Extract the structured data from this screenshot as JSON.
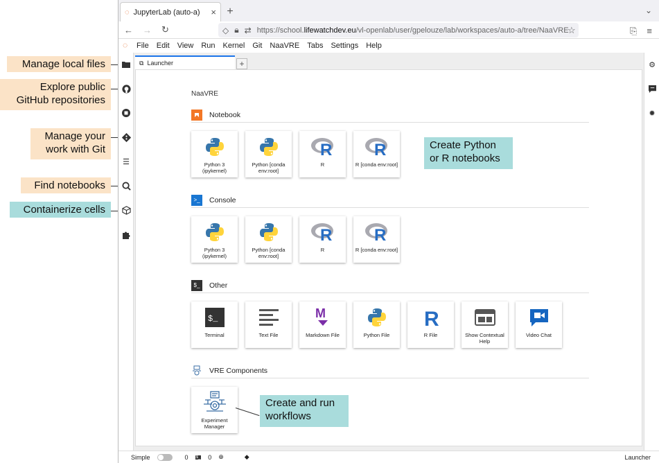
{
  "annotations": {
    "manage_files": "Manage local files",
    "explore_github": "Explore public GitHub repositories",
    "manage_git": "Manage your work with Git",
    "find_notebooks": "Find notebooks",
    "containerize": "Containerize cells",
    "create_notebooks": "Create Python or R notebooks",
    "create_workflows": "Create and run workflows"
  },
  "browser": {
    "tab_title": "JupyterLab (auto-a)",
    "url_prefix": "https://school.",
    "url_host": "lifewatchdev.eu",
    "url_path": "/vl-openlab/user/gpelouze/lab/workspaces/auto-a/tree/NaaVRE"
  },
  "menu": [
    "File",
    "Edit",
    "View",
    "Run",
    "Kernel",
    "Git",
    "NaaVRE",
    "Tabs",
    "Settings",
    "Help"
  ],
  "launcher": {
    "tab_label": "Launcher",
    "heading": "NaaVRE",
    "sections": {
      "notebook": "Notebook",
      "console": "Console",
      "other": "Other",
      "vre": "VRE Components"
    },
    "notebook_items": [
      "Python 3 (ipykernel)",
      "Python [conda env:root]",
      "R",
      "R [conda env:root]"
    ],
    "console_items": [
      "Python 3 (ipykernel)",
      "Python [conda env:root]",
      "R",
      "R [conda env:root]"
    ],
    "other_items": [
      "Terminal",
      "Text File",
      "Markdown File",
      "Python File",
      "R File",
      "Show Contextual Help",
      "Video Chat"
    ],
    "vre_items": [
      "Experiment Manager"
    ]
  },
  "status": {
    "mode": "Simple",
    "count1": "0",
    "count2": "0",
    "right": "Launcher"
  },
  "colors": {
    "python_blue": "#3776ab",
    "python_yellow": "#ffd43b",
    "r_blue": "#276dc3",
    "markdown_purple": "#7b2ea8",
    "notebook_orange": "#f37726",
    "console_blue": "#1976d2",
    "callout_peach": "#fbe3c7",
    "callout_teal": "#a9dcdc"
  }
}
